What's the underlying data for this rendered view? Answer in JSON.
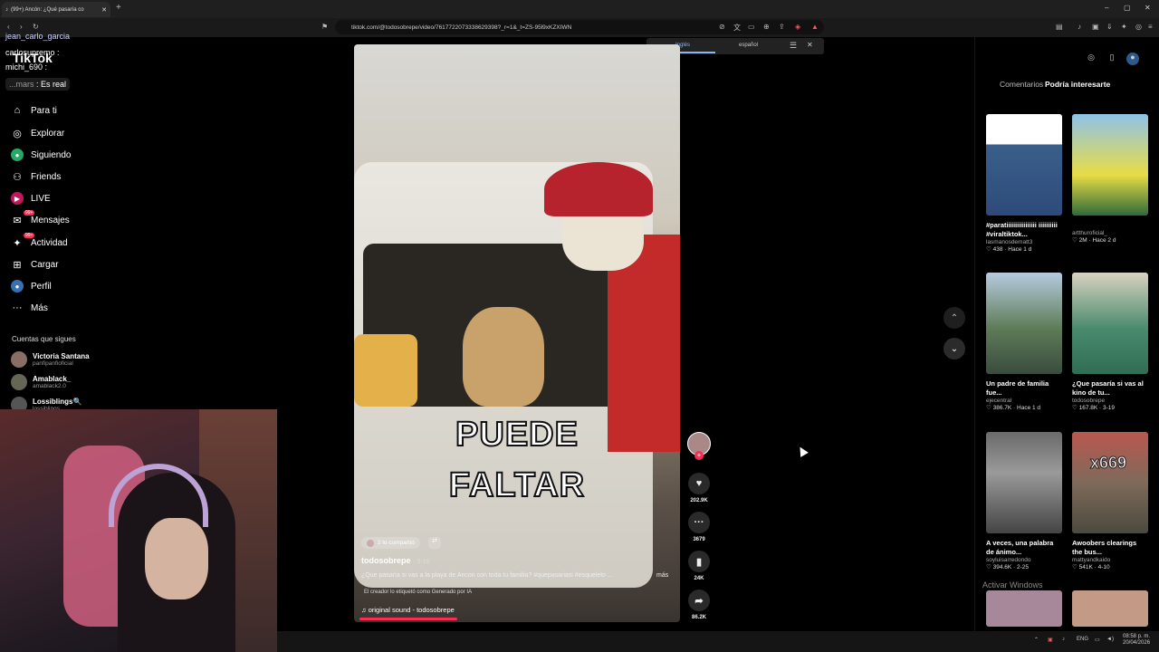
{
  "browser": {
    "tab_title": "(99+) Ancón: ¿Qué pasaría co",
    "url": "tiktok.com/@todosobrepe/video/7617722073338629398?_r=1&_t=ZS-95l9xKZXIWN"
  },
  "translate": {
    "source_lang": "Inglés",
    "target_lang": "español"
  },
  "chat": [
    {
      "user": "jean_carlo_garcia",
      "text": ""
    },
    {
      "user": "carlosupremo",
      "text": ""
    },
    {
      "user": "michi_690",
      "text": ""
    },
    {
      "user": "...mars",
      "text": ": Es real"
    }
  ],
  "logo": "TikTok",
  "nav": [
    {
      "label": "Para ti",
      "icon": "home-icon",
      "badge": ""
    },
    {
      "label": "Explorar",
      "icon": "compass-icon",
      "badge": ""
    },
    {
      "label": "Siguiendo",
      "icon": "following-icon",
      "badge": ""
    },
    {
      "label": "Friends",
      "icon": "friends-icon",
      "badge": ""
    },
    {
      "label": "LIVE",
      "icon": "live-icon",
      "badge": ""
    },
    {
      "label": "Mensajes",
      "icon": "message-icon",
      "badge": "99+"
    },
    {
      "label": "Actividad",
      "icon": "activity-icon",
      "badge": "99+"
    },
    {
      "label": "Cargar",
      "icon": "upload-icon",
      "badge": ""
    },
    {
      "label": "Perfil",
      "icon": "profile-icon",
      "badge": ""
    },
    {
      "label": "Más",
      "icon": "more-icon",
      "badge": ""
    }
  ],
  "following_title": "Cuentas que sigues",
  "following": [
    {
      "name": "Victoria Santana",
      "handle": "panfipanfioficial"
    },
    {
      "name": "Amablack_",
      "handle": "amablack2.0"
    },
    {
      "name": "Lossiblings🔍",
      "handle": "lossiblings"
    }
  ],
  "video": {
    "overlay_line1": "PUEDE",
    "overlay_line2": "FALTAR",
    "shared": "2 lo compartió",
    "author": "todosobrepe",
    "date": "· 3-16",
    "description": "¿Que pasaría si vas a la playa de Ancon con toda tu familia? #quepasariasi #esqueleto ...",
    "more": "más",
    "ai_label": "El creador lo etiquetó como Generado por IA",
    "music": "original sound - todosobrepe",
    "progress": 0.31
  },
  "actions": {
    "likes": "202.9K",
    "comments": "3679",
    "saves": "24K",
    "shares": "86.2K"
  },
  "rpanel": {
    "tab_comments": "Comentarios",
    "tab_suggest": "Podría interesarte",
    "items": [
      {
        "title": "#paratiiiiiiiiiiiiiiii iiiiiiiiii #viraltiktok...",
        "user": "lasmanosdematt3",
        "stats": "♡ 438 · Hace 1 d",
        "color": "#2d4b7a"
      },
      {
        "title": "",
        "user": "artthuroficial_",
        "stats": "♡ 2M · Hace 2 d",
        "color": "#7fb5d8"
      },
      {
        "title": "Un padre de familia fue...",
        "user": "ejecentral",
        "stats": "♡ 386.7K · Hace 1 d",
        "color": "#4d6a52"
      },
      {
        "title": "¿Que pasaría si vas al kino de tu...",
        "user": "todosobrepe",
        "stats": "♡ 167.8K · 3-19",
        "color": "#3d6c5a"
      },
      {
        "title": "A veces, una palabra de ánimo...",
        "user": "soyluisarredondo",
        "stats": "♡ 394.6K · 2-25",
        "color": "#555"
      },
      {
        "title": "Awoobers clearings the bus...",
        "user": "mattyandkaido",
        "stats": "♡ 541K · 4-10",
        "color": "#9a5a54",
        "overlay": "x669"
      },
      {
        "title": "",
        "user": "",
        "stats": "",
        "color": "#a7889a"
      },
      {
        "title": "",
        "user": "",
        "stats": "",
        "color": "#c29a86"
      }
    ]
  },
  "activate_windows": "Activar Windows",
  "taskbar": {
    "lang": "ENG",
    "time": "08:58 p. m.",
    "date": "20/04/2026"
  }
}
